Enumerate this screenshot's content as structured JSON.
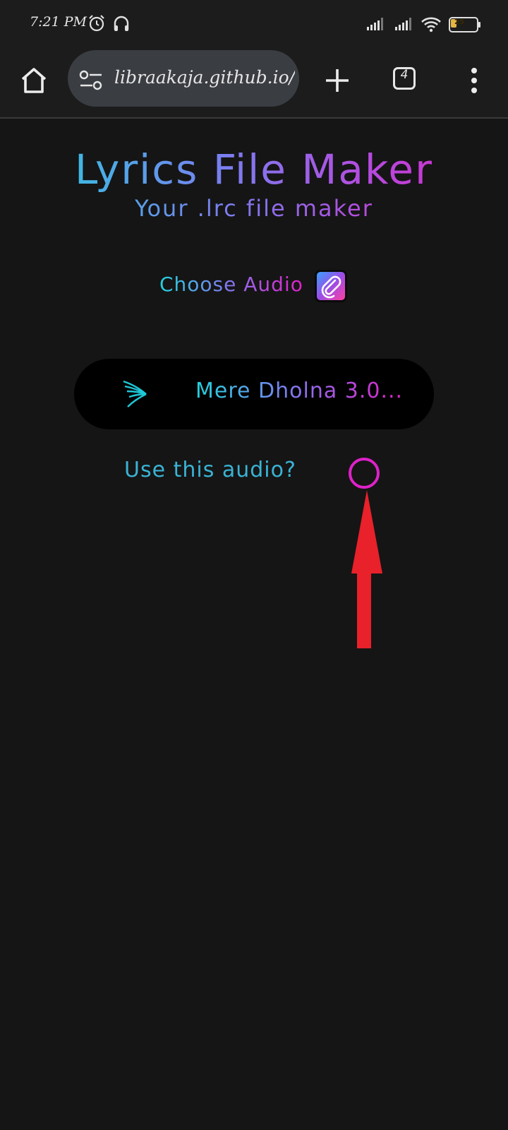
{
  "status_bar": {
    "time": "7:21 PM",
    "icons": [
      "alarm-icon",
      "headphones-icon",
      "signal-icon",
      "signal-icon",
      "wifi-icon",
      "battery-icon"
    ],
    "battery_level": "25",
    "battery_color": "#e4b545"
  },
  "browser": {
    "url": "libraakaja.github.io/",
    "tab_count": "4",
    "buttons": [
      "home-icon",
      "site-settings-icon",
      "plus-icon",
      "tabs-icon",
      "more-vert-icon"
    ]
  },
  "page": {
    "title": "Lyrics File Maker",
    "subtitle": "Your .lrc file maker",
    "choose_audio_label": "Choose Audio",
    "attach_icon": "paperclip-icon",
    "audio_icon": "music-wave-icon",
    "audio_name": "Mere Dholna 3.0...",
    "use_audio_label": "Use this audio?",
    "gradient_colors": [
      "#23d3dd",
      "#7c7df0",
      "#b14fe0",
      "#dd22c8"
    ],
    "radio_color": "#dd22c8",
    "annotation_arrow_color": "#e8212a"
  }
}
